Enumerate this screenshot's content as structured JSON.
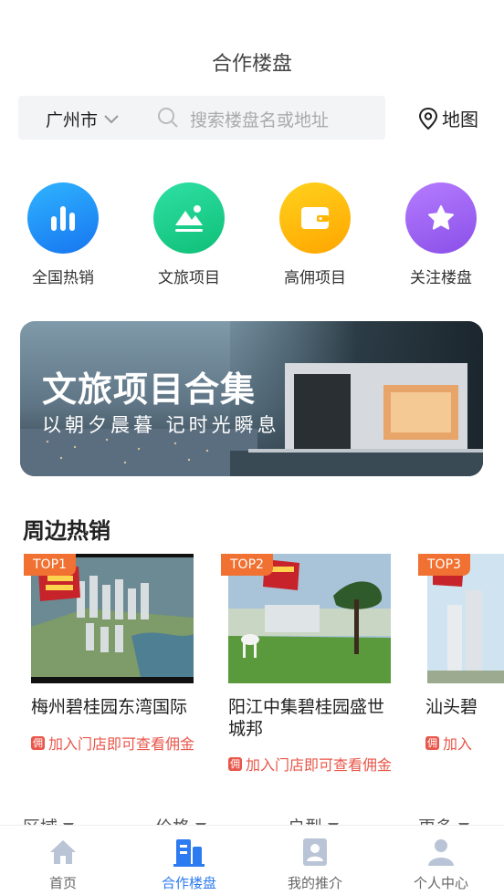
{
  "header": {
    "title": "合作楼盘"
  },
  "search": {
    "city": "广州市",
    "placeholder": "搜索楼盘名或地址",
    "map_label": "地图"
  },
  "quick_links": [
    {
      "label": "全国热销",
      "icon": "bar-chart-icon",
      "color": "#1e8ef5"
    },
    {
      "label": "文旅项目",
      "icon": "landscape-icon",
      "color": "#1ccf8c"
    },
    {
      "label": "高佣项目",
      "icon": "wallet-icon",
      "color": "#ffb400"
    },
    {
      "label": "关注楼盘",
      "icon": "star-icon",
      "color": "#9a5cf0"
    }
  ],
  "banner": {
    "title": "文旅项目合集",
    "subtitle": "以朝夕晨暮 记时光瞬息"
  },
  "hot_section": {
    "title": "周边热销",
    "items": [
      {
        "rank": "TOP1",
        "name": "梅州碧桂园东湾国际",
        "tip": "加入门店即可查看佣金"
      },
      {
        "rank": "TOP2",
        "name": "阳江中集碧桂园盛世城邦",
        "tip": "加入门店即可查看佣金"
      },
      {
        "rank": "TOP3",
        "name": "汕头碧",
        "tip": "加入"
      }
    ]
  },
  "filters": [
    "区域",
    "价格",
    "户型",
    "更多"
  ],
  "tabbar": {
    "active_color": "#2d7bf0",
    "items": [
      {
        "label": "首页",
        "icon": "home-icon"
      },
      {
        "label": "合作楼盘",
        "icon": "building-icon"
      },
      {
        "label": "我的推介",
        "icon": "profile-card-icon"
      },
      {
        "label": "个人中心",
        "icon": "user-icon"
      }
    ]
  }
}
